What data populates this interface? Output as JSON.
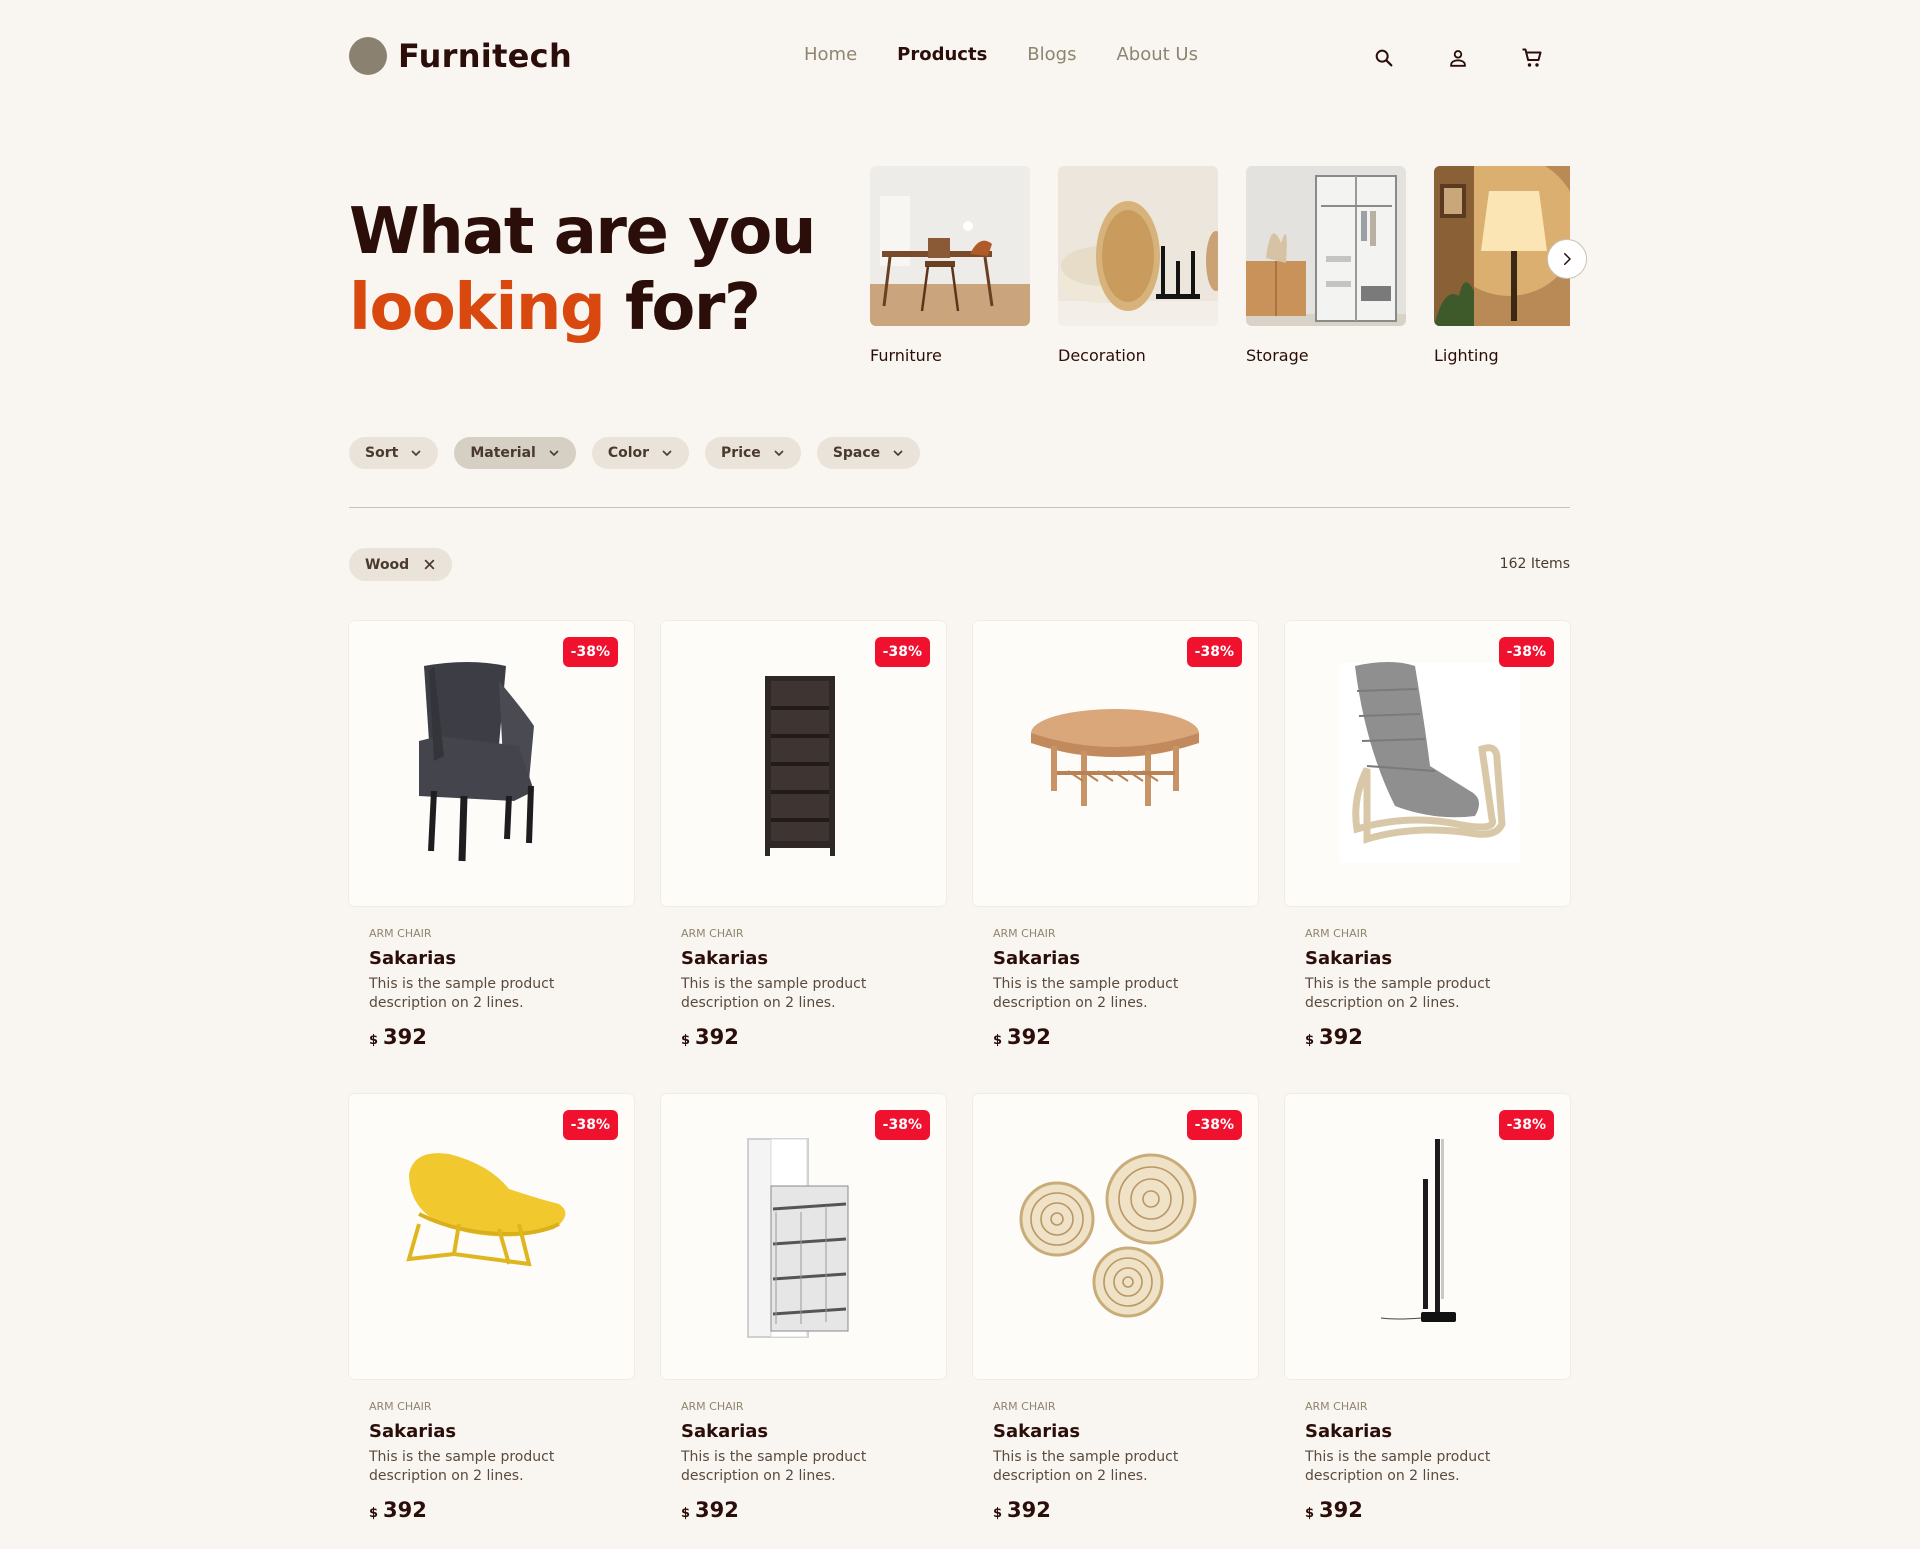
{
  "brand": {
    "name": "Furnitech"
  },
  "nav": {
    "items": [
      "Home",
      "Products",
      "Blogs",
      "About Us"
    ],
    "active": "Products"
  },
  "icons": {
    "search": "search-icon",
    "account": "user-icon",
    "cart": "cart-icon"
  },
  "hero": {
    "line1": "What are you",
    "accent": "looking",
    "rest": " for?"
  },
  "categories": [
    {
      "label": "Furniture"
    },
    {
      "label": "Decoration"
    },
    {
      "label": "Storage"
    },
    {
      "label": "Lighting"
    }
  ],
  "filters": [
    "Sort",
    "Material",
    "Color",
    "Price",
    "Space"
  ],
  "active_filter": "Material",
  "active_chips": [
    "Wood"
  ],
  "items_count": "162 Items",
  "colors": {
    "accent": "#d9480f",
    "badge": "#f0112f",
    "text": "#2b0e0a",
    "background": "#f9f6f1"
  },
  "products": [
    {
      "badge": "-38%",
      "category": "Arm Chair",
      "name": "Sakarias",
      "description": "This is the sample product description on 2 lines.",
      "currency": "$",
      "price": "392",
      "image": "dark-armchair"
    },
    {
      "badge": "-38%",
      "category": "Arm Chair",
      "name": "Sakarias",
      "description": "This is the sample product description on 2 lines.",
      "currency": "$",
      "price": "392",
      "image": "dark-bookcase"
    },
    {
      "badge": "-38%",
      "category": "Arm Chair",
      "name": "Sakarias",
      "description": "This is the sample product description on 2 lines.",
      "currency": "$",
      "price": "392",
      "image": "round-coffee-table"
    },
    {
      "badge": "-38%",
      "category": "Arm Chair",
      "name": "Sakarias",
      "description": "This is the sample product description on 2 lines.",
      "currency": "$",
      "price": "392",
      "image": "gray-lounge-chair"
    },
    {
      "badge": "-38%",
      "category": "Arm Chair",
      "name": "Sakarias",
      "description": "This is the sample product description on 2 lines.",
      "currency": "$",
      "price": "392",
      "image": "yellow-lounge-chair"
    },
    {
      "badge": "-38%",
      "category": "Arm Chair",
      "name": "Sakarias",
      "description": "This is the sample product description on 2 lines.",
      "currency": "$",
      "price": "392",
      "image": "pullout-cabinet"
    },
    {
      "badge": "-38%",
      "category": "Arm Chair",
      "name": "Sakarias",
      "description": "This is the sample product description on 2 lines.",
      "currency": "$",
      "price": "392",
      "image": "woven-wall-baskets"
    },
    {
      "badge": "-38%",
      "category": "Arm Chair",
      "name": "Sakarias",
      "description": "This is the sample product description on 2 lines.",
      "currency": "$",
      "price": "392",
      "image": "floor-lamp"
    }
  ]
}
